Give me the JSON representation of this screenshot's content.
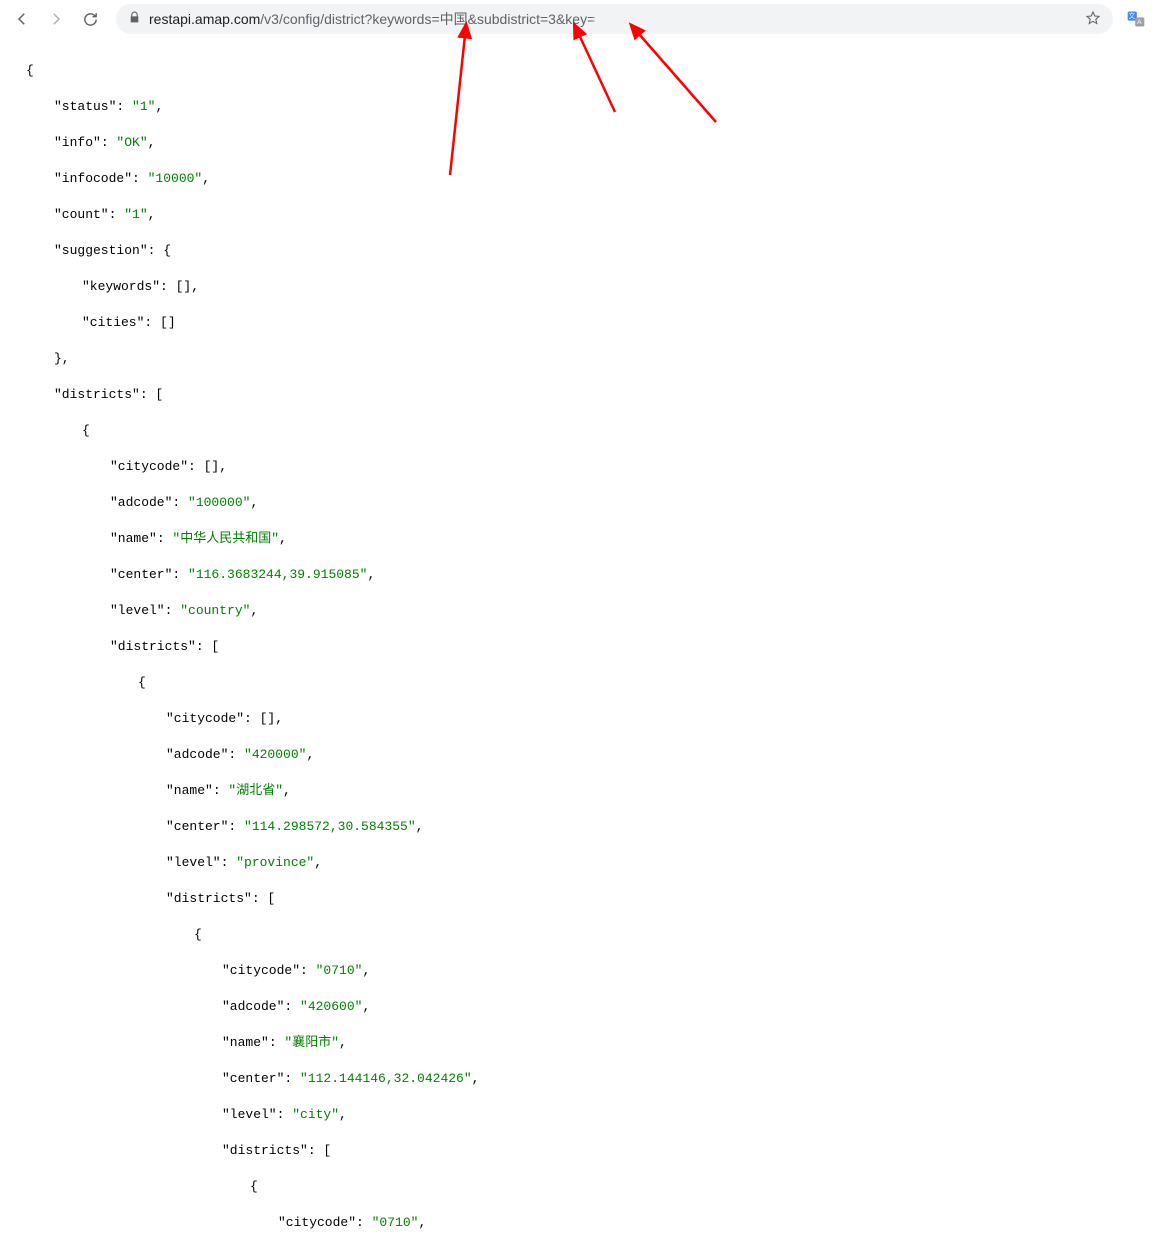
{
  "browser": {
    "url_host": "restapi.amap.com",
    "url_path": "/v3/config/district?keywords=中国&subdistrict=3&key="
  },
  "json": {
    "status": "\"1\"",
    "info": "\"OK\"",
    "infocode": "\"10000\"",
    "count": "\"1\"",
    "suggestion": {
      "keywords": "[]",
      "cities": "[]"
    },
    "districts0": {
      "citycode": "[]",
      "adcode": "\"100000\"",
      "name": "\"中华人民共和国\"",
      "center": "\"116.3683244,39.915085\"",
      "level": "\"country\""
    },
    "districts1": {
      "citycode": "[]",
      "adcode": "\"420000\"",
      "name": "\"湖北省\"",
      "center": "\"114.298572,30.584355\"",
      "level": "\"province\""
    },
    "districts2": {
      "citycode": "\"0710\"",
      "adcode": "\"420600\"",
      "name": "\"襄阳市\"",
      "center": "\"112.144146,32.042426\"",
      "level": "\"city\""
    },
    "districts3_citycode": "\"0710\"",
    "labels": {
      "status": "\"status\"",
      "info": "\"info\"",
      "infocode": "\"infocode\"",
      "count": "\"count\"",
      "suggestion": "\"suggestion\"",
      "keywords": "\"keywords\"",
      "cities": "\"cities\"",
      "districts": "\"districts\"",
      "citycode": "\"citycode\"",
      "adcode": "\"adcode\"",
      "name": "\"name\"",
      "center": "\"center\"",
      "level": "\"level\""
    }
  }
}
